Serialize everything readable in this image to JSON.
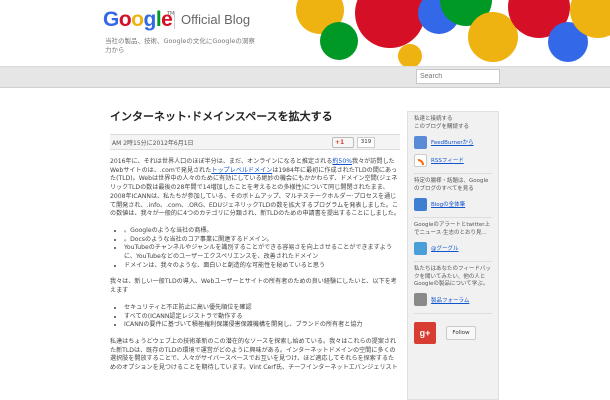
{
  "header": {
    "logo": "Google",
    "trademark": "TM",
    "blog_name": "Official Blog",
    "tagline": "当社の製品、技術、Googleの文化にGoogleの洞察力から"
  },
  "search": {
    "placeholder": "Search"
  },
  "post": {
    "title": "インターネット·ドメインスペースを拡大する",
    "date": "AM 2時15分に2012年6月1日",
    "plus_label": "+1",
    "plus_count": "319",
    "p1_before": "2016年に、それは世界人口のほぼ半分は、まだ、オンラインになると推定される",
    "p1_link1": "約50%",
    "p1_mid": "我々が訪問したWebサイトのは、.comで発見された",
    "p1_link2": "トップレベルドメイン",
    "p1_after": "は1984年に最初に作成されたTLDの間にあった(TLD)。Webは世界中の人々のために有効にしている絶妙の機会にもかかわらず、ドメイン空間(ジェネリックTLDの数は最後の28年間で14増加したことを考えるとの多様性)について同じ開閉されたまま、2008年ICANNは、私たちが参加している、そのボトムアップ、マルチステークホルダー·プロセスを通じて開発され、.info、.com、.ORG、EDUジェネリックTLDの数を拡大するプログラムを発表しました。この数値は、我々が一般的に4つのカテゴリに分類され、新TLDのための申請書を提出することにしました。",
    "list1": [
      "。Googleのような当社の商標。",
      "。Docsのような当社のコア事業に関連するドメイン。",
      "YouTubeのチャンネルやジャンルを識別することができる容易さを向上させることができますように、YouTubeなどのユーザーエクスペリエンスを、改善されたドメイン",
      "ドメインは、我々のような、面白いと創造的な可能性を秘めていると思う"
    ],
    "p2": "我々は、新しい一般TLDの導入、Webユーザーとサイトの所有者のための良い経験にしたいと、以下を考えます",
    "list2": [
      "セキュリティと不正防止に高い優先順位を確認",
      "すべての(ICANN認定レジストラで動作する",
      "ICANNの要件に基づいて積極権利保護侵害保護機構を開発し、ブランドの所有者と協力"
    ],
    "p3": "私達はちょうどウェブ上の技術革新のこの潜在的なソースを探索し始めている。我々はこれらの提案された新TLDは、既存のTLDの環境で運営がどのように興味がある。インターネットドメインの空間に多くの選択肢を開放することで、人々がサイバースペースでお互いを見つけ、ほど適応してそれらを探索するためのオプションを見つけることを期待しています。Vint Cerf氏、チーフインターネットエバンジェリスト"
  },
  "sidebar": {
    "follow_title": "私達と接続する\nこのブログを購読する",
    "feedburner": "FeedBurnerから",
    "rss": "RSSフィード",
    "other_blogs_title": "特定の腸様・話題は、Googleのブログのすべてを見る",
    "blog_directory": "Blogの全体筆",
    "twitter_title": "Googleのアラートとtwitter上でニュース·生志のとおり見...",
    "twitter": "@グーグル",
    "feedback_title": "私たちはあなたのフィードバックを聞いてみたい、他の人とGoogleの製品について学ぶ。",
    "forum": "製品フォーラム",
    "gplus": "g+",
    "follow_button": "Follow"
  },
  "colors": {
    "google_blue": "#3369e8",
    "google_red": "#d50f25",
    "google_yellow": "#eeb211",
    "google_green": "#009925",
    "link": "#1155cc"
  }
}
